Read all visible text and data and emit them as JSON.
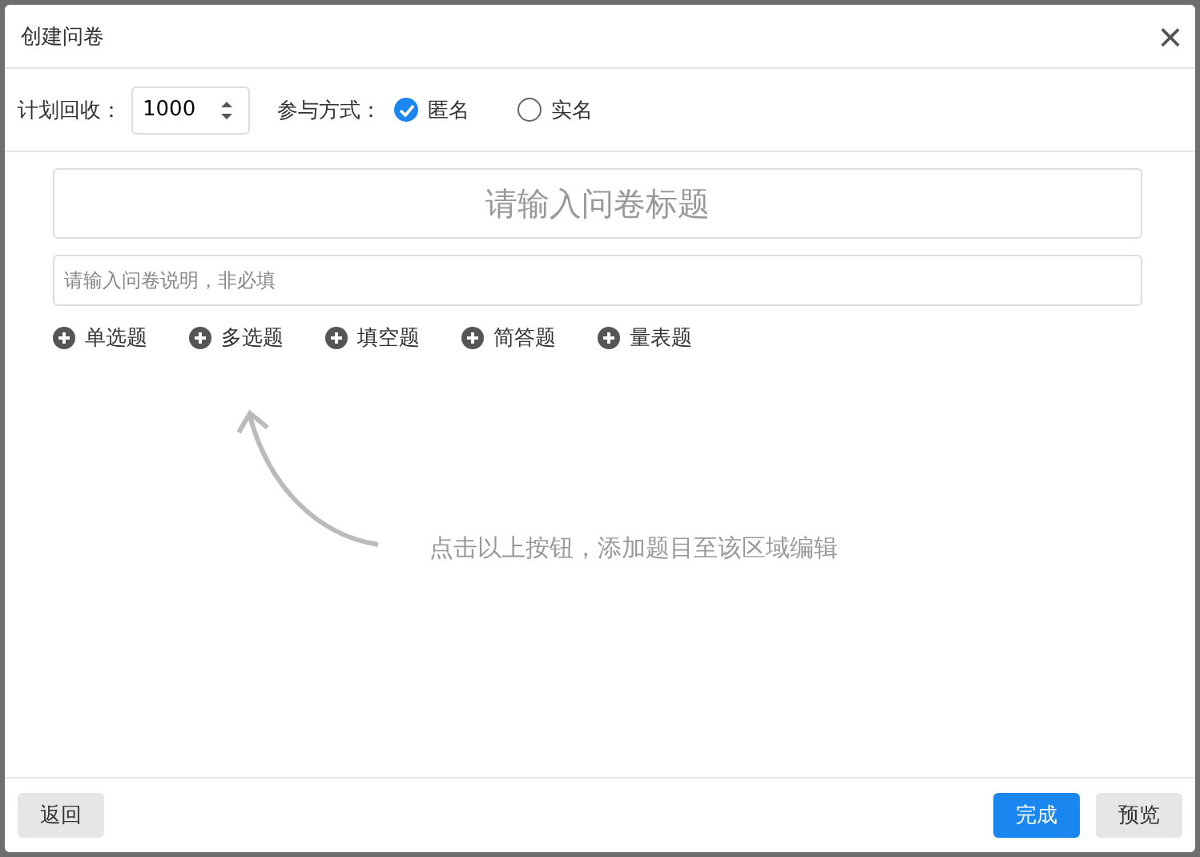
{
  "dialog": {
    "title": "创建问卷",
    "close": "×"
  },
  "settings": {
    "quota_label": "计划回收：",
    "quota_value": "1000",
    "mode_label": "参与方式：",
    "modes": [
      {
        "label": "匿名",
        "selected": true
      },
      {
        "label": "实名",
        "selected": false
      }
    ]
  },
  "title_field": {
    "placeholder": "请输入问卷标题"
  },
  "description_field": {
    "placeholder": "请输入问卷说明，非必填"
  },
  "add_buttons": [
    "单选题",
    "多选题",
    "填空题",
    "简答题",
    "量表题"
  ],
  "hint": "点击以上按钮，添加题目至该区域编辑",
  "footer": {
    "back": "返回",
    "done": "完成",
    "preview": "预览"
  }
}
